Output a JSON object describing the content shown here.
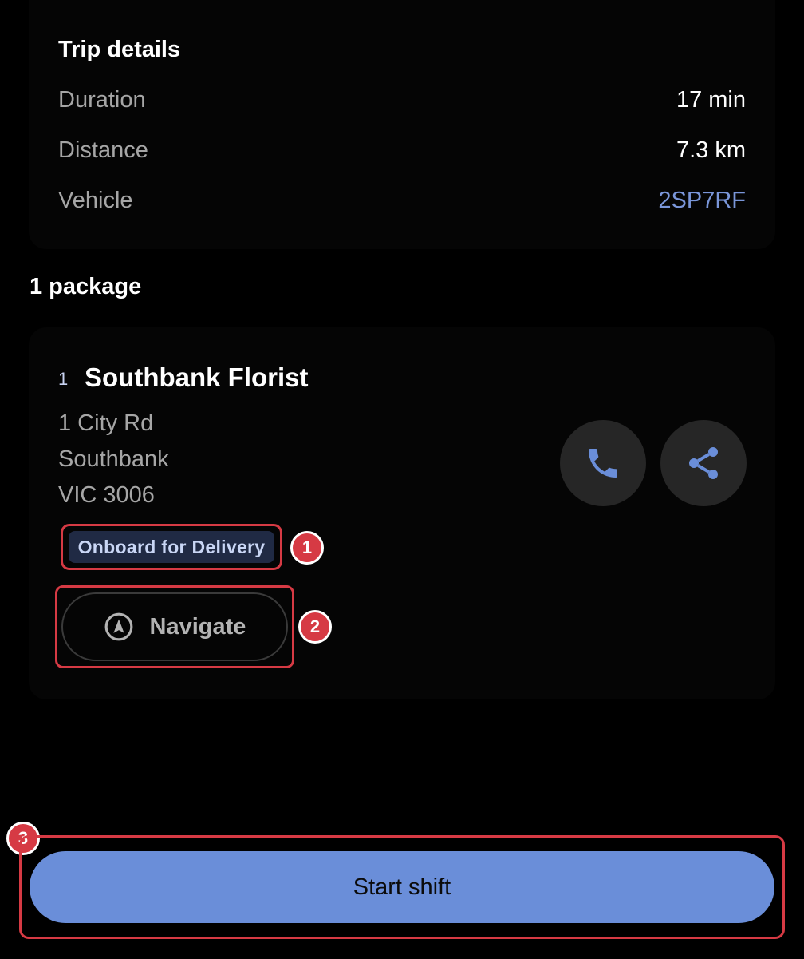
{
  "trip": {
    "title": "Trip details",
    "rows": [
      {
        "label": "Duration",
        "value": "17 min"
      },
      {
        "label": "Distance",
        "value": "7.3 km"
      },
      {
        "label": "Vehicle",
        "value": "2SP7RF"
      }
    ]
  },
  "packages": {
    "heading": "1 package",
    "item": {
      "index": "1",
      "name": "Southbank Florist",
      "address": [
        "1 City Rd",
        "Southbank",
        "VIC 3006"
      ],
      "status": "Onboard for Delivery",
      "navigate_label": "Navigate",
      "call_icon": "phone-icon",
      "share_icon": "share-icon"
    }
  },
  "markers": [
    "1",
    "2",
    "3"
  ],
  "actions": {
    "start_shift_label": "Start shift"
  },
  "colors": {
    "accent": "#6a8ed9",
    "link": "#7a96d9",
    "marker": "#d63a44"
  }
}
